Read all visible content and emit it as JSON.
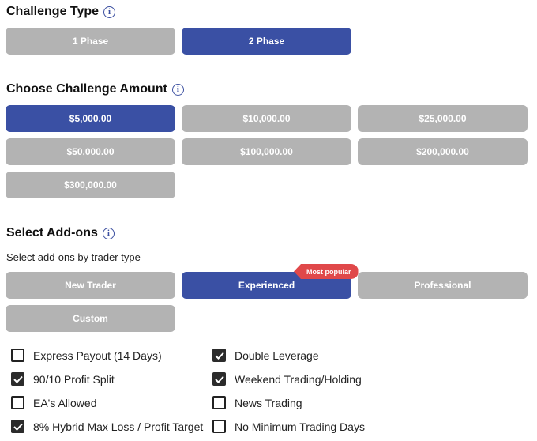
{
  "challenge_type": {
    "heading": "Challenge Type",
    "options": [
      "1 Phase",
      "2 Phase"
    ],
    "selected": "2 Phase"
  },
  "challenge_amount": {
    "heading": "Choose Challenge Amount",
    "options": [
      "$5,000.00",
      "$10,000.00",
      "$25,000.00",
      "$50,000.00",
      "$100,000.00",
      "$200,000.00",
      "$300,000.00"
    ],
    "selected": "$5,000.00"
  },
  "addons": {
    "heading": "Select Add-ons",
    "subtitle": "Select add-ons by trader type",
    "trader_types": [
      "New Trader",
      "Experienced",
      "Professional",
      "Custom"
    ],
    "selected_type": "Experienced",
    "badge": "Most popular",
    "items": [
      {
        "label": "Express Payout (14 Days)",
        "checked": false
      },
      {
        "label": "Double Leverage",
        "checked": true
      },
      {
        "label": "90/10 Profit Split",
        "checked": true
      },
      {
        "label": "Weekend Trading/Holding",
        "checked": true
      },
      {
        "label": "EA's Allowed",
        "checked": false
      },
      {
        "label": "News Trading",
        "checked": false
      },
      {
        "label": "8% Hybrid Max Loss / Profit Target",
        "checked": true
      },
      {
        "label": "No Minimum Trading Days",
        "checked": false
      }
    ]
  },
  "icons": {
    "info": "info-icon",
    "check": "checkmark-icon"
  },
  "colors": {
    "selected": "#3a50a4",
    "unselected": "#b3b3b3",
    "badge": "#e0484a"
  }
}
